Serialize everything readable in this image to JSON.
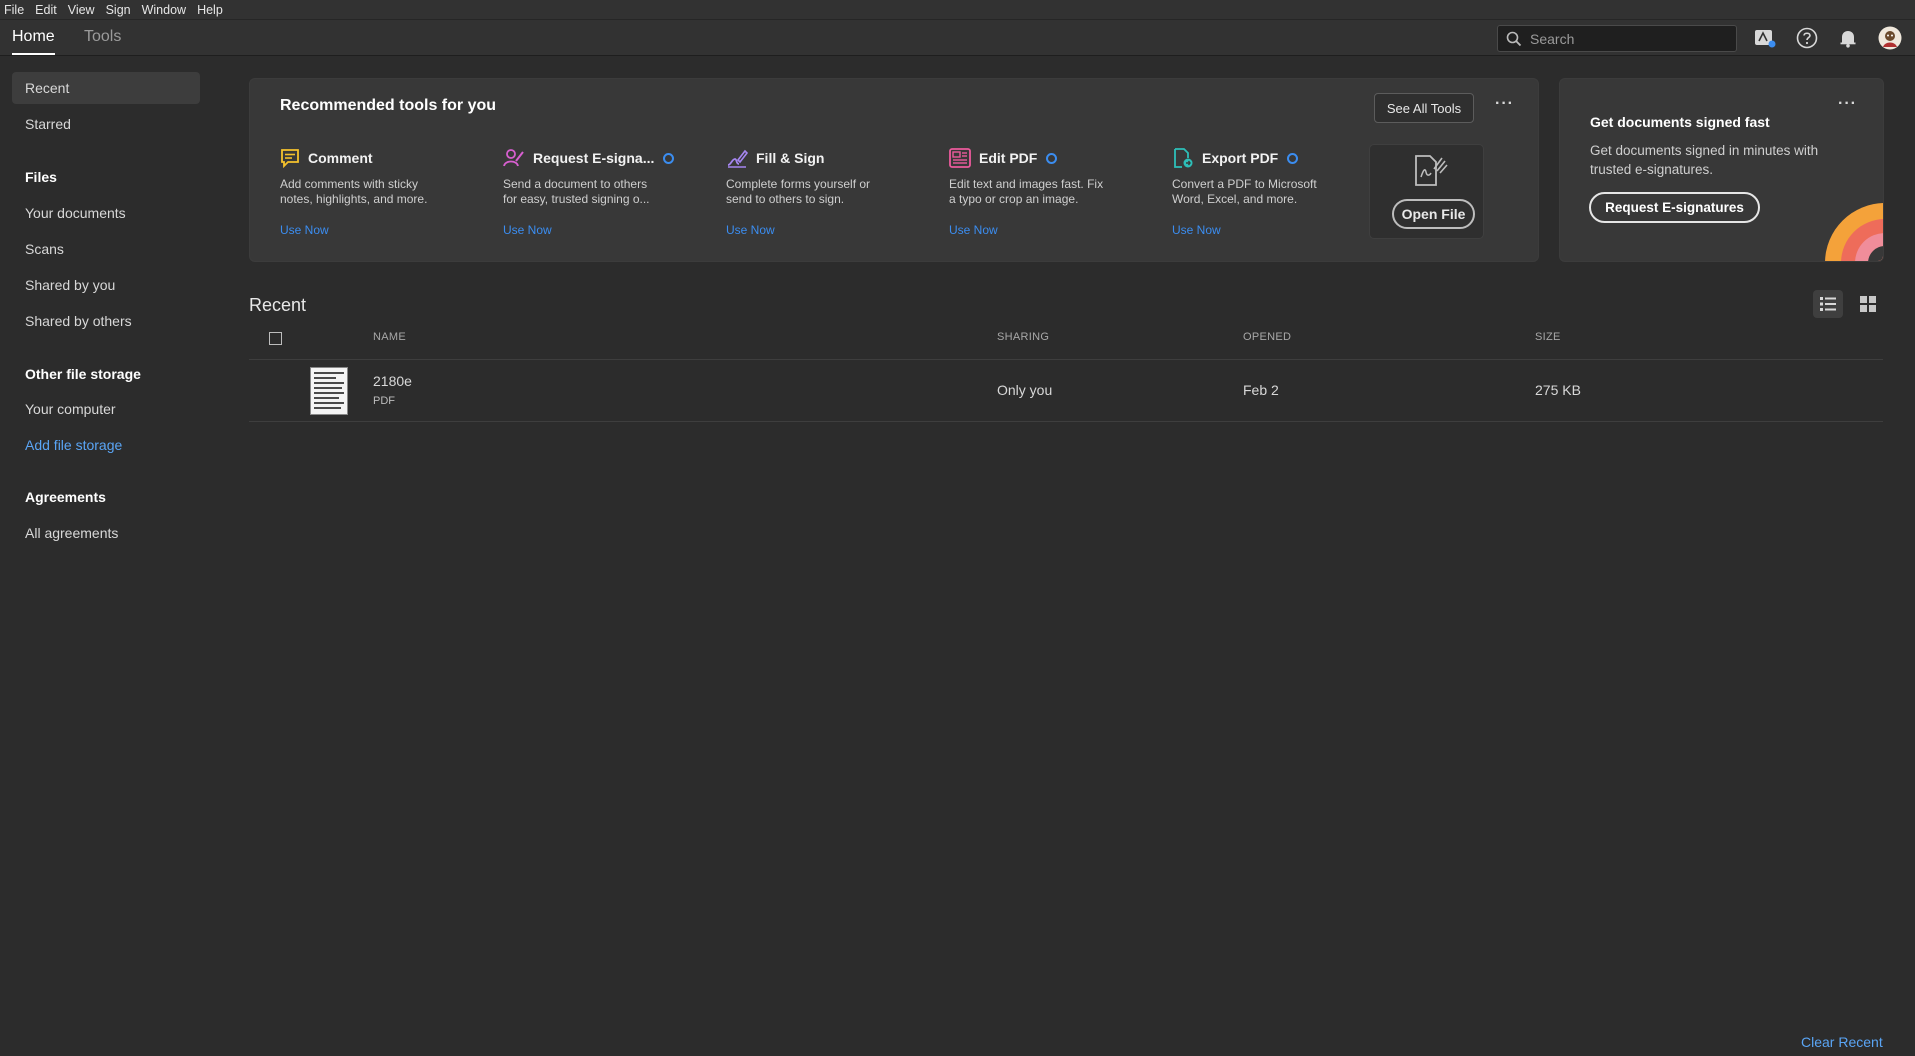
{
  "menu": [
    "File",
    "Edit",
    "View",
    "Sign",
    "Window",
    "Help"
  ],
  "nav": {
    "tabs": [
      "Home",
      "Tools"
    ],
    "active_tab": "Home",
    "search_placeholder": "Search"
  },
  "sidebar": {
    "items": [
      {
        "label": "Recent",
        "selected": true
      },
      {
        "label": "Starred"
      }
    ],
    "files_heading": "Files",
    "files": [
      "Your documents",
      "Scans",
      "Shared by you",
      "Shared by others"
    ],
    "other_heading": "Other file storage",
    "other": [
      "Your computer",
      "Add file storage"
    ],
    "agreements_heading": "Agreements",
    "agreements": [
      "All agreements"
    ]
  },
  "recommended": {
    "title": "Recommended tools for you",
    "see_all": "See All Tools",
    "more": "···",
    "tools": [
      {
        "name": "Comment",
        "icon": "comment-icon",
        "color": "#f5c22c",
        "desc1": "Add comments with sticky",
        "desc2": "notes, highlights, and more.",
        "cta": "Use Now",
        "badge": false
      },
      {
        "name": "Request E-signa...",
        "icon": "request-esign-icon",
        "color": "#d85fd0",
        "desc1": "Send a document to others",
        "desc2": "for easy, trusted signing o...",
        "cta": "Use Now",
        "badge": true
      },
      {
        "name": "Fill & Sign",
        "icon": "fill-sign-icon",
        "color": "#a586f0",
        "desc1": "Complete forms yourself or",
        "desc2": "send to others to sign.",
        "cta": "Use Now",
        "badge": false
      },
      {
        "name": "Edit PDF",
        "icon": "edit-pdf-icon",
        "color": "#ec5a9c",
        "desc1": "Edit text and images fast. Fix",
        "desc2": "a typo or crop an image.",
        "cta": "Use Now",
        "badge": true
      },
      {
        "name": "Export PDF",
        "icon": "export-pdf-icon",
        "color": "#2dbfb8",
        "desc1": "Convert a PDF to Microsoft",
        "desc2": "Word, Excel, and more.",
        "cta": "Use Now",
        "badge": true
      }
    ],
    "open_file": "Open File"
  },
  "sign_card": {
    "title": "Get documents signed fast",
    "desc": "Get documents signed in minutes with trusted e-signatures.",
    "button": "Request E-signatures",
    "more": "···"
  },
  "recent": {
    "title": "Recent",
    "columns": {
      "name": "NAME",
      "sharing": "SHARING",
      "opened": "OPENED",
      "size": "SIZE"
    },
    "rows": [
      {
        "name": "2180e",
        "type": "PDF",
        "sharing": "Only you",
        "opened": "Feb 2",
        "size": "275 KB"
      }
    ],
    "clear": "Clear Recent"
  },
  "colors": {
    "accent": "#3b8df0",
    "link": "#5aa5f5",
    "background": "#2c2c2c",
    "card": "#383838"
  }
}
